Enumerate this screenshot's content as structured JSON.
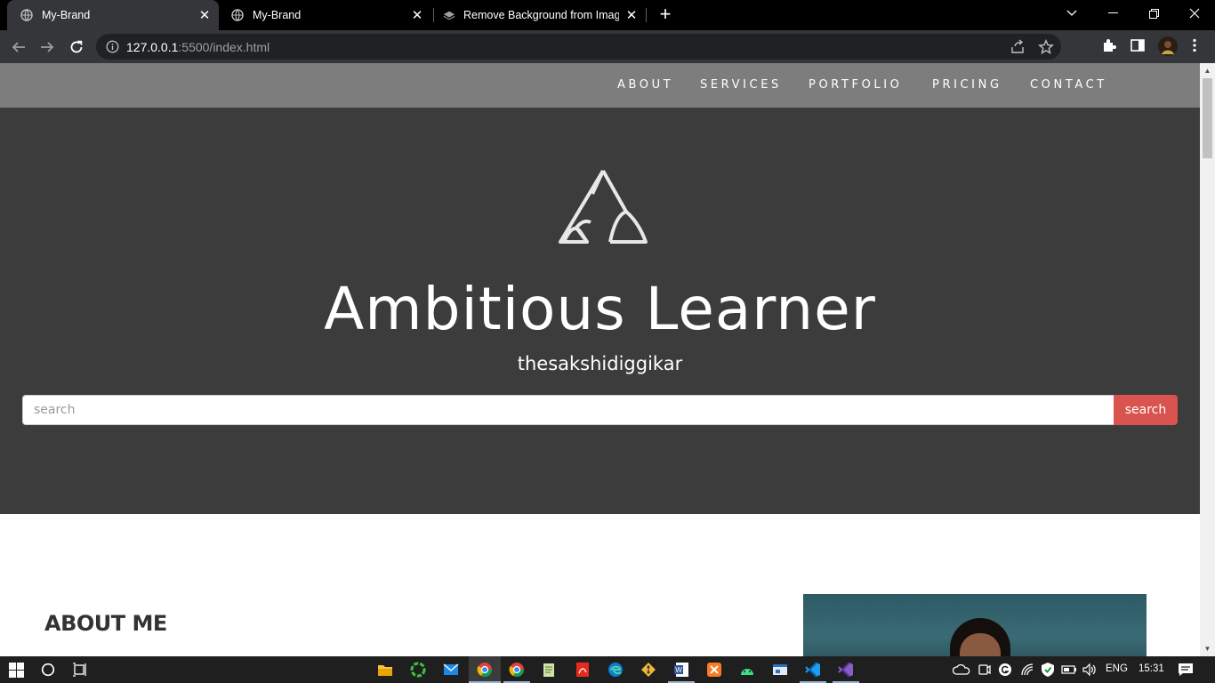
{
  "browser": {
    "tabs": [
      {
        "title": "My-Brand",
        "active": true
      },
      {
        "title": "My-Brand",
        "active": false
      },
      {
        "title": "Remove Background from Image",
        "active": false
      }
    ],
    "url_host": "127.0.0.1",
    "url_rest": ":5500/index.html"
  },
  "site": {
    "nav": [
      "ABOUT",
      "SERVICES",
      "PORTFOLIO",
      "PRICING",
      "CONTACT"
    ],
    "hero": {
      "title": "Ambitious Learner",
      "tagline": "thesakshidiggikar",
      "search_placeholder": "search",
      "search_button": "search"
    },
    "about": {
      "title": "ABOUT ME"
    }
  },
  "taskbar": {
    "language": "ENG",
    "time": "15:31"
  },
  "colors": {
    "nav_bg": "#7d7d7d",
    "hero_bg": "#3c3c3c",
    "search_button": "#d9534f"
  }
}
